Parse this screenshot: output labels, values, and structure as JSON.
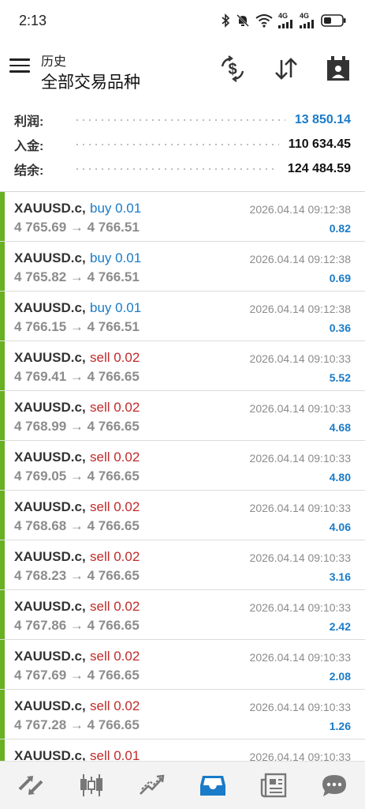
{
  "status": {
    "time": "2:13",
    "net1": "4G",
    "net2": "4G"
  },
  "header": {
    "title_small": "历史",
    "title_main": "全部交易品种",
    "actions": [
      "currency-exchange-icon",
      "sort-icon",
      "calendar-icon"
    ]
  },
  "summary": [
    {
      "label": "利润:",
      "value": "13 850.14",
      "color": "#1a7bc8"
    },
    {
      "label": "入金:",
      "value": "110 634.45",
      "color": "#111111"
    },
    {
      "label": "结余:",
      "value": "124 484.59",
      "color": "#111111"
    }
  ],
  "colors": {
    "buy": "#1a7bc8",
    "sell": "#c22a2a",
    "accent_bar": "#6ab023",
    "active_nav": "#1a7bc8"
  },
  "trades": [
    {
      "symbol": "XAUUSD.c,",
      "side": "buy 0.01",
      "type": "buy",
      "prices": "4 765.69 → 4 766.51",
      "time": "2026.04.14 09:12:38",
      "profit": "0.82"
    },
    {
      "symbol": "XAUUSD.c,",
      "side": "buy 0.01",
      "type": "buy",
      "prices": "4 765.82 → 4 766.51",
      "time": "2026.04.14 09:12:38",
      "profit": "0.69"
    },
    {
      "symbol": "XAUUSD.c,",
      "side": "buy 0.01",
      "type": "buy",
      "prices": "4 766.15 → 4 766.51",
      "time": "2026.04.14 09:12:38",
      "profit": "0.36"
    },
    {
      "symbol": "XAUUSD.c,",
      "side": "sell 0.02",
      "type": "sell",
      "prices": "4 769.41 → 4 766.65",
      "time": "2026.04.14 09:10:33",
      "profit": "5.52"
    },
    {
      "symbol": "XAUUSD.c,",
      "side": "sell 0.02",
      "type": "sell",
      "prices": "4 768.99 → 4 766.65",
      "time": "2026.04.14 09:10:33",
      "profit": "4.68"
    },
    {
      "symbol": "XAUUSD.c,",
      "side": "sell 0.02",
      "type": "sell",
      "prices": "4 769.05 → 4 766.65",
      "time": "2026.04.14 09:10:33",
      "profit": "4.80"
    },
    {
      "symbol": "XAUUSD.c,",
      "side": "sell 0.02",
      "type": "sell",
      "prices": "4 768.68 → 4 766.65",
      "time": "2026.04.14 09:10:33",
      "profit": "4.06"
    },
    {
      "symbol": "XAUUSD.c,",
      "side": "sell 0.02",
      "type": "sell",
      "prices": "4 768.23 → 4 766.65",
      "time": "2026.04.14 09:10:33",
      "profit": "3.16"
    },
    {
      "symbol": "XAUUSD.c,",
      "side": "sell 0.02",
      "type": "sell",
      "prices": "4 767.86 → 4 766.65",
      "time": "2026.04.14 09:10:33",
      "profit": "2.42"
    },
    {
      "symbol": "XAUUSD.c,",
      "side": "sell 0.02",
      "type": "sell",
      "prices": "4 767.69 → 4 766.65",
      "time": "2026.04.14 09:10:33",
      "profit": "2.08"
    },
    {
      "symbol": "XAUUSD.c,",
      "side": "sell 0.02",
      "type": "sell",
      "prices": "4 767.28 → 4 766.65",
      "time": "2026.04.14 09:10:33",
      "profit": "1.26"
    },
    {
      "symbol": "XAUUSD.c,",
      "side": "sell 0.01",
      "type": "sell",
      "prices": "",
      "time": "2026.04.14 09:10:33",
      "profit": ""
    }
  ],
  "nav": [
    {
      "icon": "quotes-icon",
      "active": false
    },
    {
      "icon": "chart-candles-icon",
      "active": false
    },
    {
      "icon": "trade-icon",
      "active": false
    },
    {
      "icon": "history-inbox-icon",
      "active": true
    },
    {
      "icon": "news-icon",
      "active": false
    },
    {
      "icon": "messages-icon",
      "active": false
    }
  ]
}
